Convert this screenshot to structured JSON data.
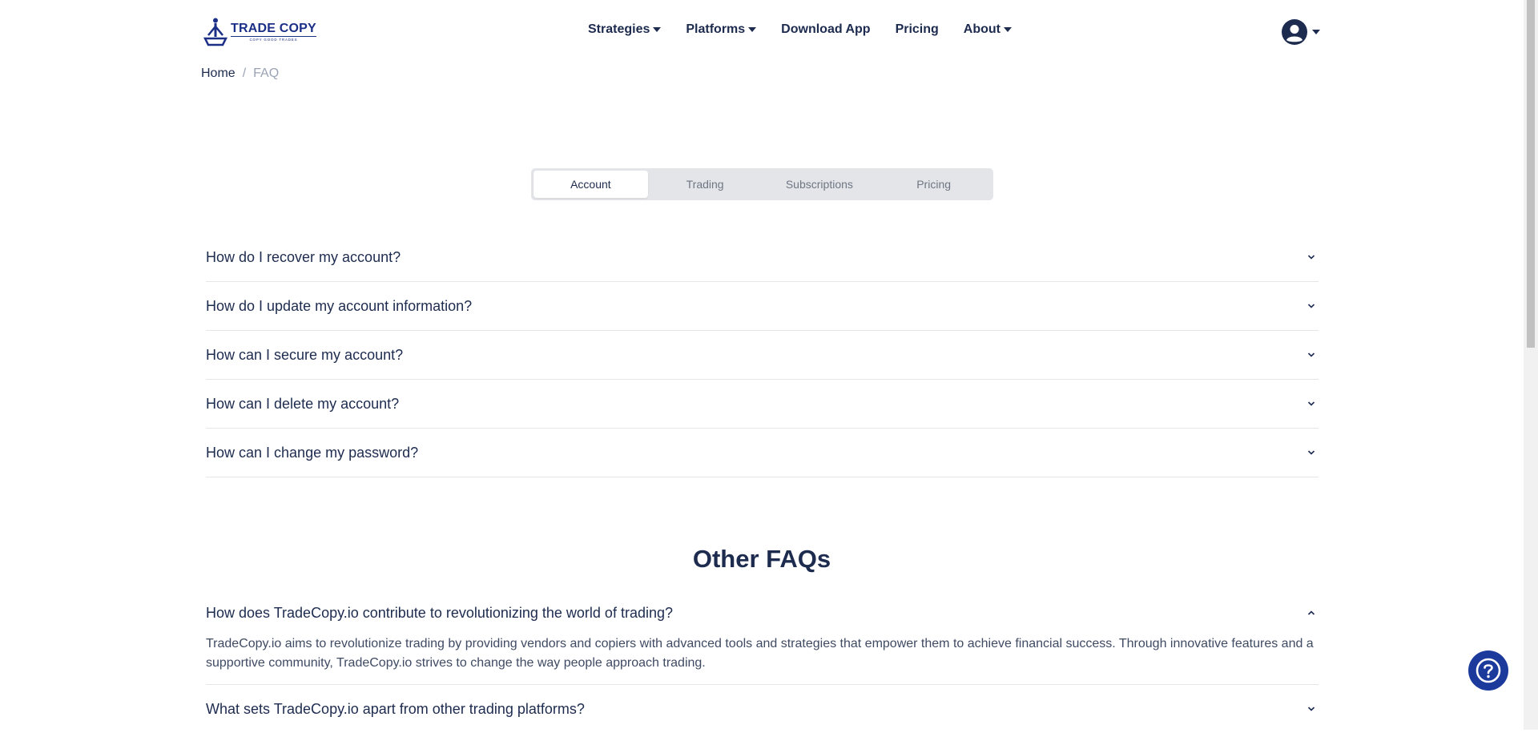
{
  "brand": {
    "name": "TRADE COPY",
    "tagline": "COPY GOOD TRADES",
    "colors": {
      "primary": "#1b2f86",
      "text": "#1d2b4f",
      "muted": "#9aa3b5",
      "help": "#1c3a9b"
    }
  },
  "nav": {
    "items": [
      {
        "label": "Strategies",
        "has_dropdown": true
      },
      {
        "label": "Platforms",
        "has_dropdown": true
      },
      {
        "label": "Download App",
        "has_dropdown": false
      },
      {
        "label": "Pricing",
        "has_dropdown": false
      },
      {
        "label": "About",
        "has_dropdown": true
      }
    ],
    "user_icon": "user-circle-icon"
  },
  "breadcrumb": {
    "home": "Home",
    "separator": "/",
    "current": "FAQ"
  },
  "tabs": [
    {
      "label": "Account",
      "active": true
    },
    {
      "label": "Trading",
      "active": false
    },
    {
      "label": "Subscriptions",
      "active": false
    },
    {
      "label": "Pricing",
      "active": false
    }
  ],
  "account_faqs": [
    {
      "question": "How do I recover my account?",
      "expanded": false
    },
    {
      "question": "How do I update my account information?",
      "expanded": false
    },
    {
      "question": "How can I secure my account?",
      "expanded": false
    },
    {
      "question": "How can I delete my account?",
      "expanded": false
    },
    {
      "question": "How can I change my password?",
      "expanded": false
    }
  ],
  "other_faqs": {
    "title": "Other FAQs",
    "items": [
      {
        "question": "How does TradeCopy.io contribute to revolutionizing the world of trading?",
        "expanded": true,
        "answer": "TradeCopy.io aims to revolutionize trading by providing vendors and copiers with advanced tools and strategies that empower them to achieve financial success. Through innovative features and a supportive community, TradeCopy.io strives to change the way people approach trading."
      },
      {
        "question": "What sets TradeCopy.io apart from other trading platforms?",
        "expanded": false
      }
    ]
  },
  "help_button": {
    "icon": "question-mark-icon"
  }
}
